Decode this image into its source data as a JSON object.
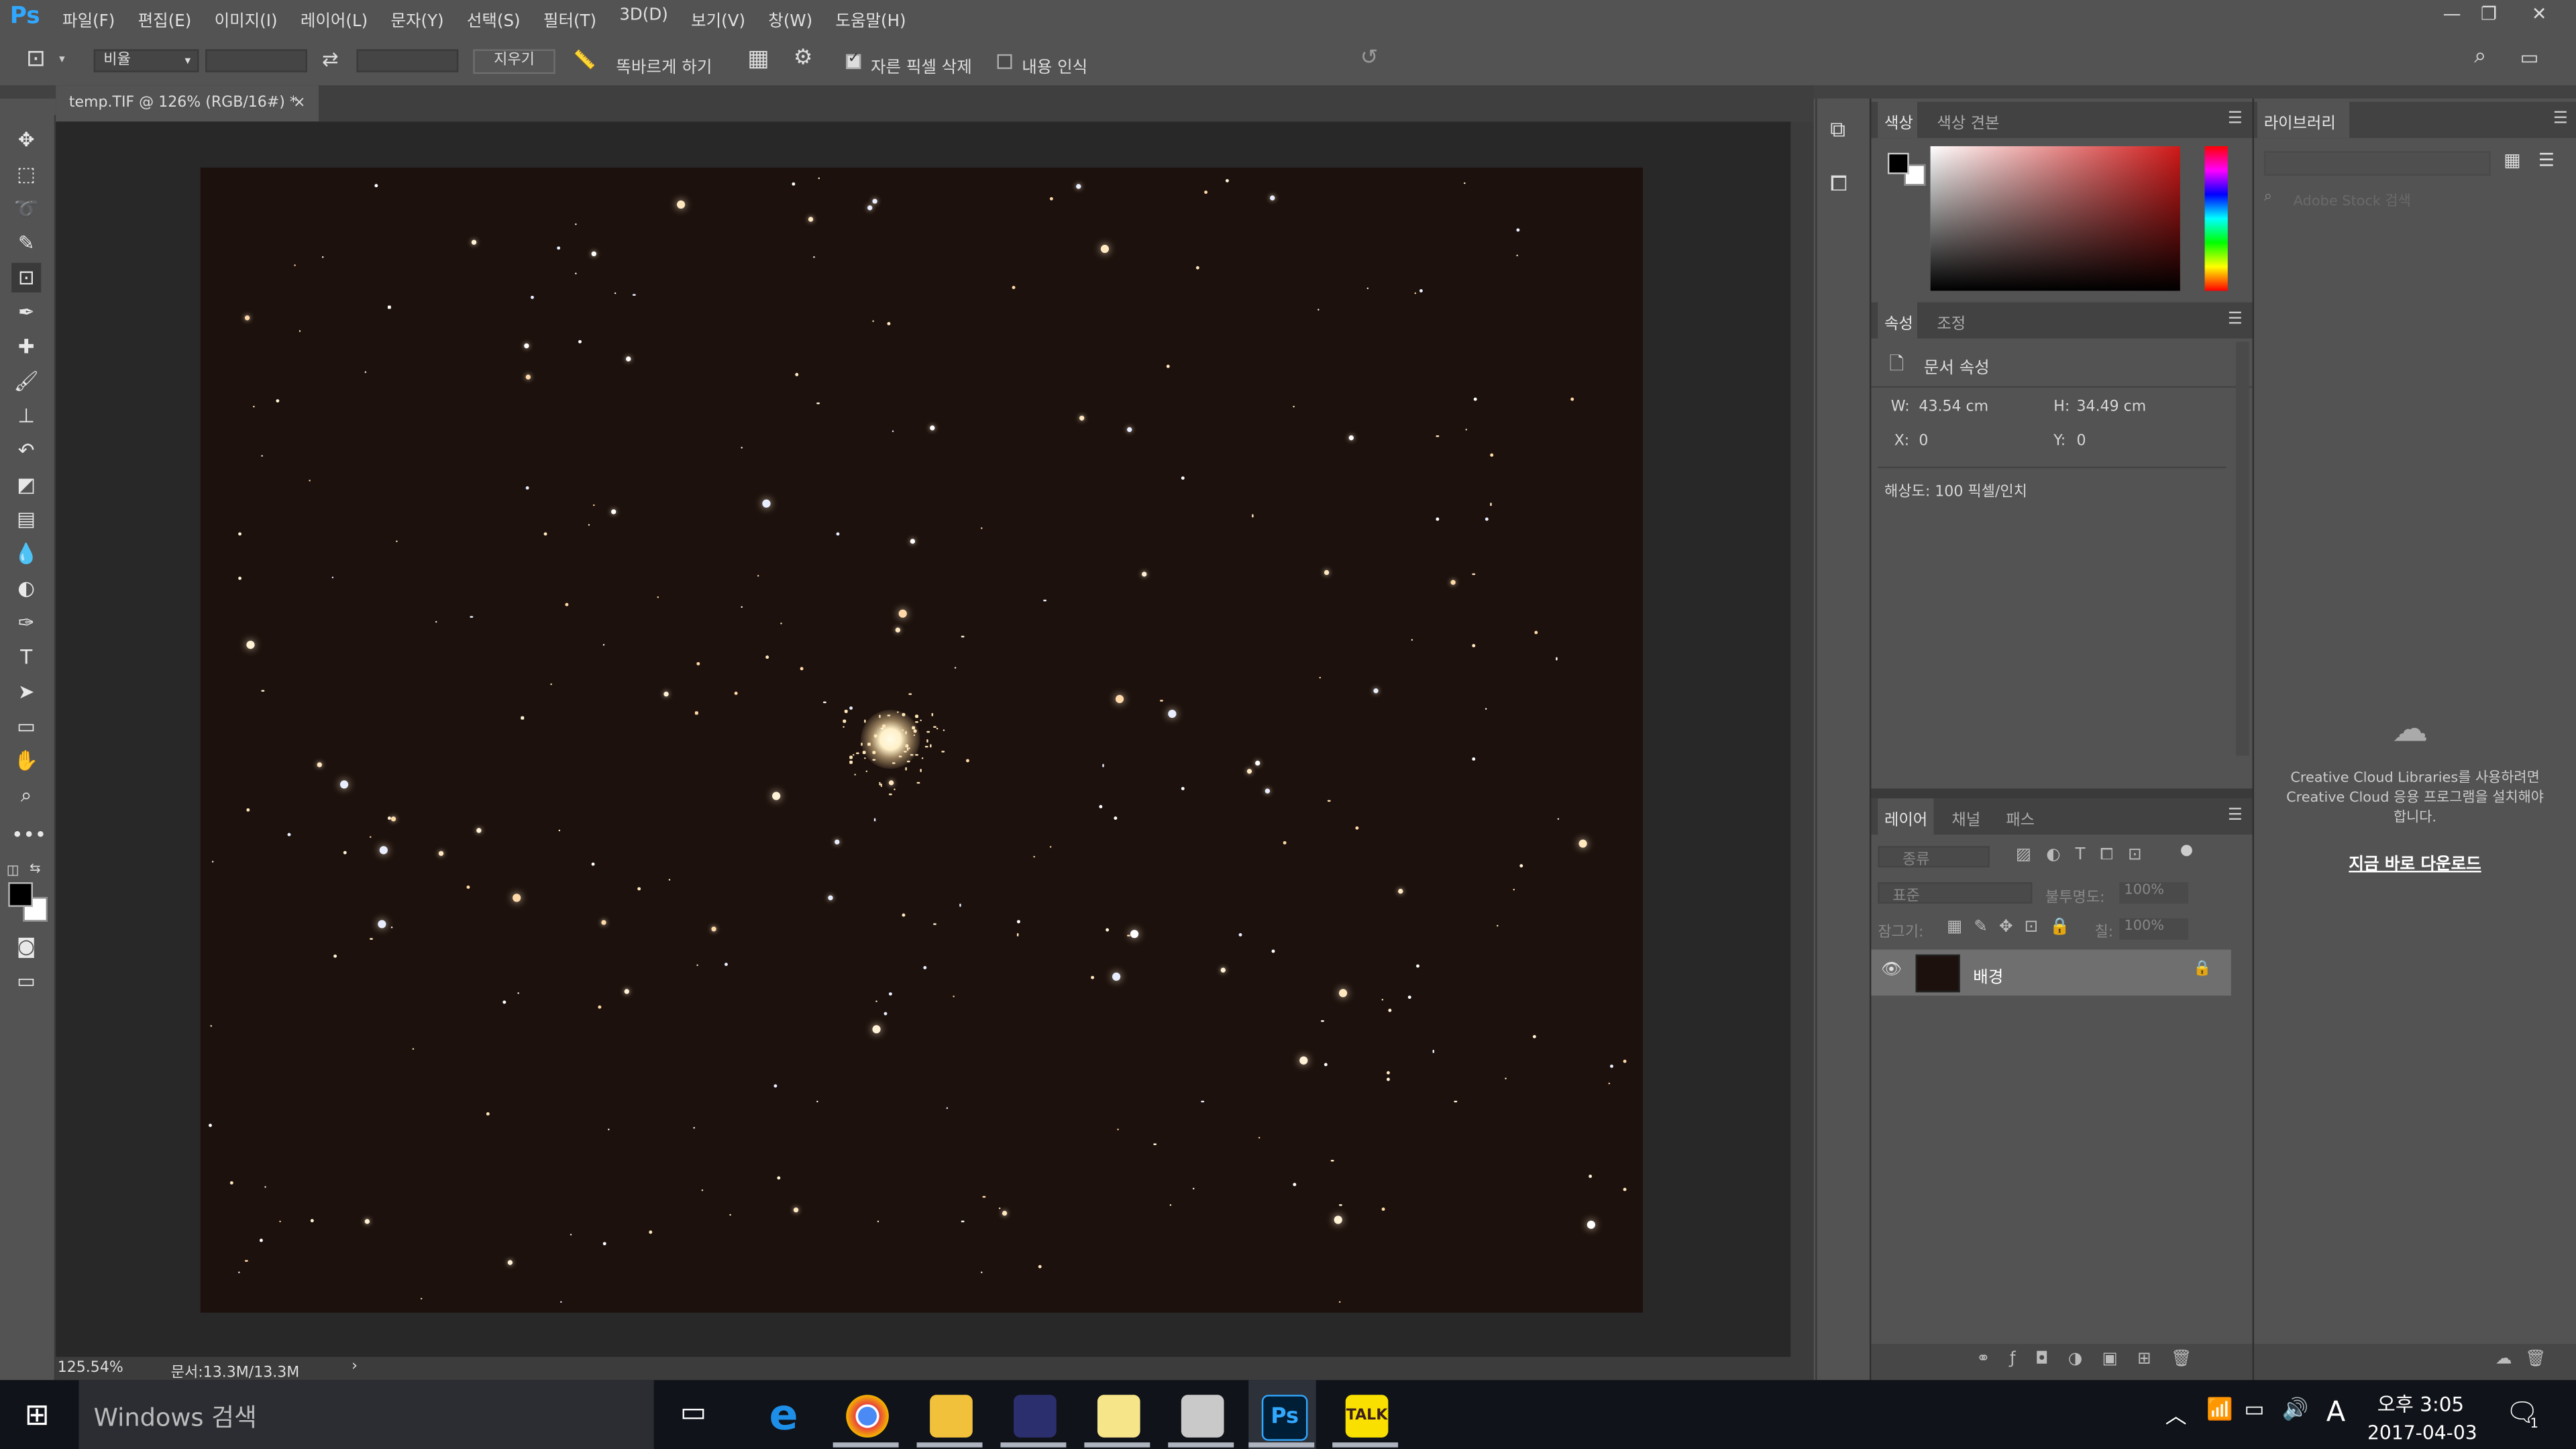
{
  "app": {
    "logo": "Ps"
  },
  "menu": [
    "파일(F)",
    "편집(E)",
    "이미지(I)",
    "레이어(L)",
    "문자(Y)",
    "선택(S)",
    "필터(T)",
    "3D(D)",
    "보기(V)",
    "창(W)",
    "도움말(H)"
  ],
  "window_controls": {
    "minimize": "—",
    "restore": "❐",
    "close": "✕"
  },
  "options": {
    "ratio_select": "비율",
    "clear_button": "지우기",
    "straighten_label": "똑바르게 하기",
    "delete_cropped_label": "자른 픽셀 삭제",
    "delete_cropped_checked": true,
    "content_aware_label": "내용 인식",
    "content_aware_checked": false
  },
  "document": {
    "tab_title": "temp.TIF @ 126% (RGB/16#) *",
    "tab_close": "×"
  },
  "status": {
    "zoom": "125.54%",
    "doc_info": "문서:13.3M/13.3M",
    "arrow": "›"
  },
  "color_panel": {
    "tab_color": "색상",
    "tab_swatches": "색상 견본",
    "accent": "#d01818"
  },
  "properties_panel": {
    "tab_properties": "속성",
    "tab_adjust": "조정",
    "doc_props_label": "문서 속성",
    "w_label": "W:",
    "w_value": "43.54 cm",
    "h_label": "H:",
    "h_value": "34.49 cm",
    "x_label": "X:",
    "x_value": "0",
    "y_label": "Y:",
    "y_value": "0",
    "resolution": "해상도: 100 픽셀/인치"
  },
  "layers_panel": {
    "tab_layers": "레이어",
    "tab_channels": "채널",
    "tab_paths": "패스",
    "filter_label": "종류",
    "blend_mode": "표준",
    "opacity_label": "불투명도:",
    "opacity_value": "100%",
    "lock_label": "잠그기:",
    "fill_label": "칠:",
    "fill_value": "100%",
    "layer_name": "배경"
  },
  "library_panel": {
    "tab_title": "라이브러리",
    "search_placeholder": "Adobe Stock 검색",
    "message": "Creative Cloud Libraries를 사용하려면 Creative Cloud 응용 프로그램을 설치해야 합니다.",
    "download_link": "지금 바로 다운로드"
  },
  "taskbar": {
    "search_placeholder": "Windows 검색",
    "time": "오후 3:05",
    "date": "2017-04-03",
    "ime": "A",
    "notification_count": "1"
  }
}
